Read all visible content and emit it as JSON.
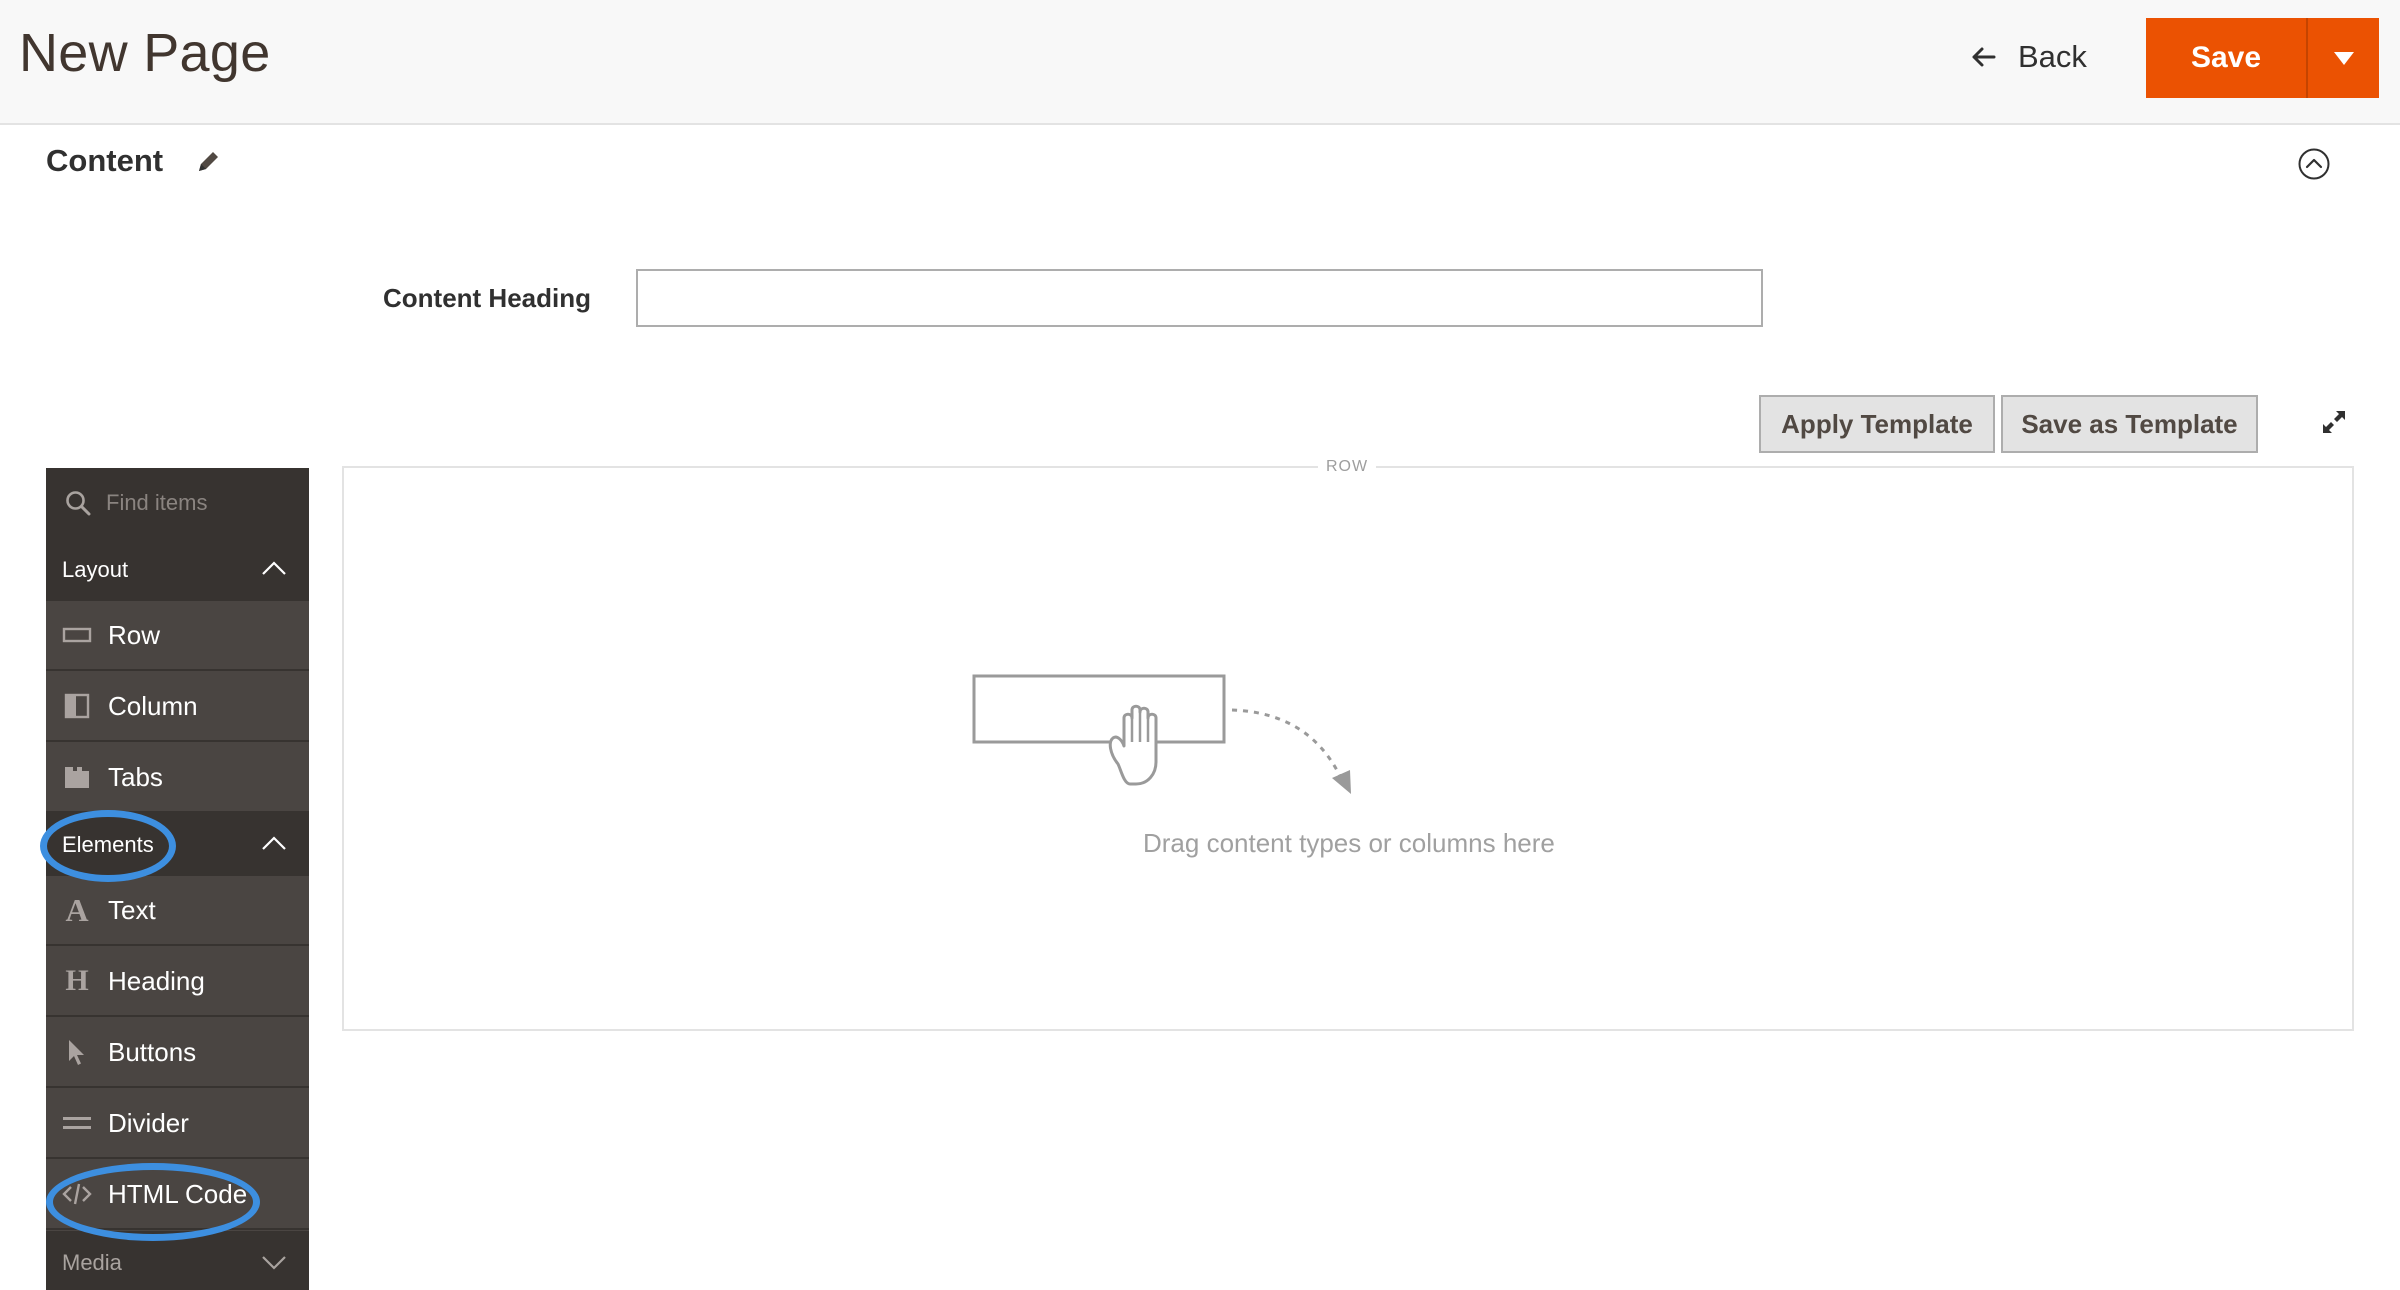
{
  "header": {
    "title": "New Page",
    "back_label": "Back",
    "save_label": "Save"
  },
  "section": {
    "title": "Content"
  },
  "form": {
    "content_heading_label": "Content Heading",
    "content_heading_value": ""
  },
  "toolbar": {
    "apply_template_label": "Apply Template",
    "save_as_template_label": "Save as Template"
  },
  "panel": {
    "search_placeholder": "Find items",
    "groups": [
      {
        "label": "Layout",
        "state": "expanded",
        "items": [
          {
            "label": "Row",
            "icon": "row-icon"
          },
          {
            "label": "Column",
            "icon": "column-icon"
          },
          {
            "label": "Tabs",
            "icon": "tabs-icon"
          }
        ]
      },
      {
        "label": "Elements",
        "state": "expanded",
        "highlighted": true,
        "items": [
          {
            "label": "Text",
            "icon": "text-icon"
          },
          {
            "label": "Heading",
            "icon": "heading-icon"
          },
          {
            "label": "Buttons",
            "icon": "cursor-icon"
          },
          {
            "label": "Divider",
            "icon": "divider-icon"
          },
          {
            "label": "HTML Code",
            "icon": "code-icon",
            "highlighted": true
          }
        ]
      },
      {
        "label": "Media",
        "state": "collapsed"
      }
    ]
  },
  "stage": {
    "row_label": "ROW",
    "drop_hint": "Drag content types or columns here"
  },
  "colors": {
    "accent": "#eb5202",
    "panel_bg": "#4a4542",
    "panel_header_bg": "#373330",
    "highlight": "#3d8fe0"
  }
}
